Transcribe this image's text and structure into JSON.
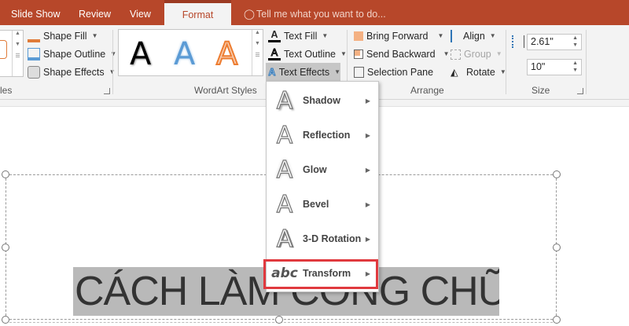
{
  "tabs": {
    "slide_show": "Slide Show",
    "review": "Review",
    "view": "View",
    "format": "Format",
    "tell_me": "Tell me what you want to do..."
  },
  "shape_styles": {
    "group_label_partial": "les",
    "shape_fill": "Shape Fill",
    "shape_outline": "Shape Outline",
    "shape_effects": "Shape Effects"
  },
  "wordart": {
    "group_label": "WordArt Styles",
    "samples": [
      "A",
      "A",
      "A"
    ],
    "text_fill": "Text Fill",
    "text_outline": "Text Outline",
    "text_effects": "Text Effects"
  },
  "arrange": {
    "group_label": "Arrange",
    "bring_forward": "Bring Forward",
    "send_backward": "Send Backward",
    "selection_pane": "Selection Pane",
    "align": "Align",
    "group": "Group",
    "rotate": "Rotate"
  },
  "size": {
    "group_label": "Size",
    "height": "2.61\"",
    "width": "10\""
  },
  "menu": {
    "items": [
      {
        "label": "Shadow",
        "icon": "A"
      },
      {
        "label": "Reflection",
        "icon": "A"
      },
      {
        "label": "Glow",
        "icon": "A"
      },
      {
        "label": "Bevel",
        "icon": "A"
      },
      {
        "label": "3-D Rotation",
        "icon": "A"
      },
      {
        "label": "Transform",
        "icon": "abc"
      }
    ]
  },
  "slide": {
    "text": "CÁCH LÀM CONG CHỮ"
  },
  "colors": {
    "accent": "#B7472A",
    "highlight": "#E0393E"
  }
}
